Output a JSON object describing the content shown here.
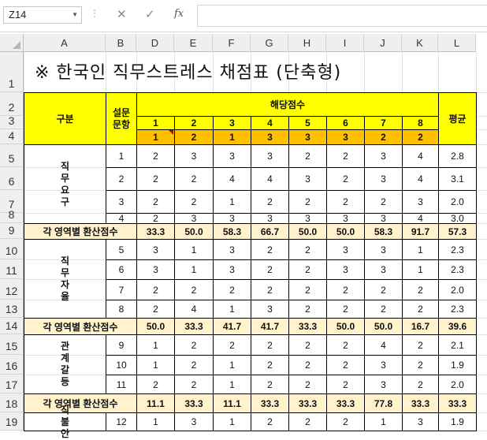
{
  "namebox": {
    "value": "Z14"
  },
  "formula": {
    "value": ""
  },
  "columns": [
    "A",
    "B",
    "D",
    "E",
    "F",
    "G",
    "H",
    "I",
    "J",
    "K",
    "L"
  ],
  "rows": [
    "1",
    "2",
    "3",
    "4",
    "5",
    "6",
    "7",
    "8",
    "9",
    "10",
    "11",
    "12",
    "13",
    "14",
    "15",
    "16",
    "17",
    "18",
    "19"
  ],
  "title": "※ 한국인 직무스트레스 채점표 (단축형)",
  "headers": {
    "gubun": "구분",
    "question_line1": "설문",
    "question_line2": "문항",
    "score_group": "해당점수",
    "average": "평균",
    "score_cols": [
      "1",
      "2",
      "3",
      "4",
      "5",
      "6",
      "7",
      "8"
    ],
    "max_values": [
      "1",
      "2",
      "1",
      "3",
      "3",
      "3",
      "2",
      "2"
    ]
  },
  "summary_label": "각 영역별 환산점수",
  "sections": [
    {
      "name_chars": [
        "직",
        "무",
        "요",
        "구"
      ],
      "rows": [
        {
          "q": "1",
          "s": [
            "2",
            "3",
            "3",
            "3",
            "2",
            "2",
            "3",
            "4"
          ],
          "avg": "2.8"
        },
        {
          "q": "2",
          "s": [
            "2",
            "2",
            "4",
            "4",
            "3",
            "2",
            "3",
            "4"
          ],
          "avg": "3.1"
        },
        {
          "q": "3",
          "s": [
            "2",
            "2",
            "1",
            "2",
            "2",
            "2",
            "2",
            "3"
          ],
          "avg": "2.0"
        },
        {
          "q": "4",
          "s": [
            "2",
            "3",
            "3",
            "3",
            "3",
            "3",
            "3",
            "4"
          ],
          "avg": "3.0"
        }
      ],
      "summary": {
        "s": [
          "33.3",
          "50.0",
          "58.3",
          "66.7",
          "50.0",
          "50.0",
          "58.3",
          "91.7"
        ],
        "avg": "57.3"
      }
    },
    {
      "name_chars": [
        "직",
        "무",
        "자",
        "율"
      ],
      "rows": [
        {
          "q": "5",
          "s": [
            "3",
            "1",
            "3",
            "2",
            "2",
            "3",
            "3",
            "1"
          ],
          "avg": "2.3"
        },
        {
          "q": "6",
          "s": [
            "3",
            "1",
            "3",
            "2",
            "2",
            "3",
            "3",
            "1"
          ],
          "avg": "2.3"
        },
        {
          "q": "7",
          "s": [
            "2",
            "2",
            "2",
            "2",
            "2",
            "2",
            "2",
            "2"
          ],
          "avg": "2.0"
        },
        {
          "q": "8",
          "s": [
            "2",
            "4",
            "1",
            "3",
            "2",
            "2",
            "2",
            "2"
          ],
          "avg": "2.3"
        }
      ],
      "summary": {
        "s": [
          "50.0",
          "33.3",
          "41.7",
          "41.7",
          "33.3",
          "50.0",
          "50.0",
          "16.7"
        ],
        "avg": "39.6"
      }
    },
    {
      "name_chars": [
        "관",
        "계",
        "갈",
        "등"
      ],
      "rows": [
        {
          "q": "9",
          "s": [
            "1",
            "2",
            "2",
            "2",
            "2",
            "2",
            "4",
            "2"
          ],
          "avg": "2.1"
        },
        {
          "q": "10",
          "s": [
            "1",
            "2",
            "1",
            "2",
            "2",
            "2",
            "3",
            "2"
          ],
          "avg": "1.9"
        },
        {
          "q": "11",
          "s": [
            "2",
            "2",
            "1",
            "2",
            "2",
            "2",
            "3",
            "2"
          ],
          "avg": "2.0"
        }
      ],
      "summary": {
        "s": [
          "11.1",
          "33.3",
          "11.1",
          "33.3",
          "33.3",
          "33.3",
          "77.8",
          "33.3"
        ],
        "avg": "33.3"
      }
    },
    {
      "name_chars": [
        "직",
        "불",
        "안"
      ],
      "rows": [
        {
          "q": "12",
          "s": [
            "1",
            "3",
            "1",
            "2",
            "2",
            "2",
            "1",
            "3"
          ],
          "avg": "1.9"
        }
      ]
    }
  ]
}
